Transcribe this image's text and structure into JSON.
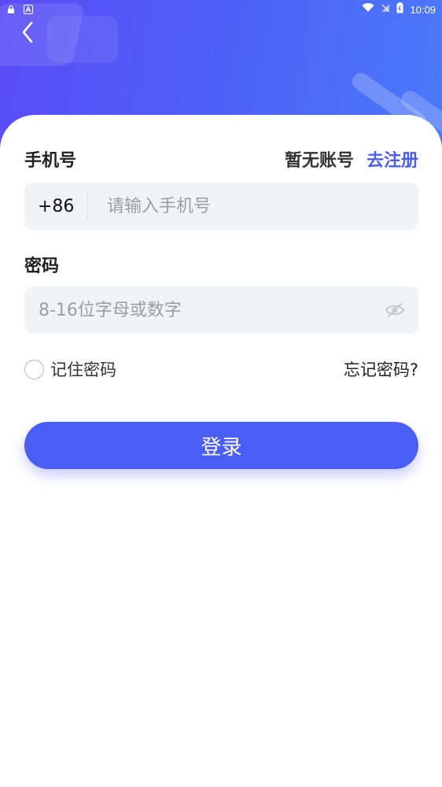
{
  "status_bar": {
    "time": "10:09"
  },
  "header": {
    "back_icon": "chevron-left-icon"
  },
  "form": {
    "phone_label": "手机号",
    "no_account": "暂无账号",
    "register_link": "去注册",
    "country_code": "+86",
    "phone_placeholder": "请输入手机号",
    "phone_value": "",
    "password_label": "密码",
    "password_placeholder": "8-16位字母或数字",
    "password_value": "",
    "remember_label": "记住密码",
    "forgot_label": "忘记密码?",
    "login_label": "登录"
  },
  "colors": {
    "accent": "#4a5ef5",
    "header_start": "#5a4cf5",
    "header_end": "#4a7af8",
    "field_bg": "#f1f3f7"
  }
}
